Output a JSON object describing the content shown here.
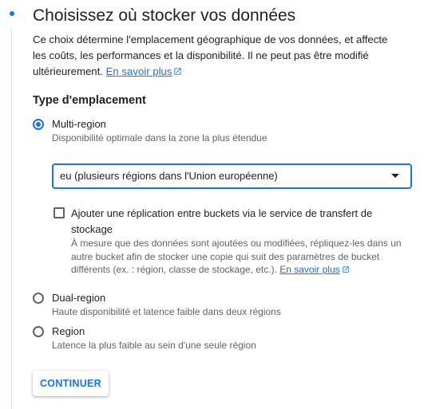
{
  "step": {
    "title": "Choisissez où stocker vos données",
    "description": "Ce choix détermine l'emplacement géographique de vos données, et affecte les coûts, les performances et la disponibilité. Il ne peut pas être modifié ultérieurement.",
    "learn_more": "En savoir plus"
  },
  "location_type": {
    "heading": "Type d'emplacement",
    "options": [
      {
        "label": "Multi-region",
        "description": "Disponibilité optimale dans la zone la plus étendue",
        "selected": true
      },
      {
        "label": "Dual-region",
        "description": "Haute disponibilité et latence faible dans deux régions",
        "selected": false
      },
      {
        "label": "Region",
        "description": "Latence la plus faible au sein d'une seule région",
        "selected": false
      }
    ]
  },
  "multi_region_select": {
    "value": "eu (plusieurs régions dans l'Union européenne)"
  },
  "replication": {
    "checked": false,
    "label": "Ajouter une réplication entre buckets via le service de transfert de stockage",
    "description": "À mesure que des données sont ajoutées ou modifiées, répliquez-les dans un autre bucket afin de stocker une copie qui suit des paramètres de bucket différents (ex. : région, classe de stockage, etc.).",
    "learn_more": "En savoir plus"
  },
  "continue_button": "CONTINUER",
  "colors": {
    "accent": "#1a73e8",
    "text": "#202124",
    "secondary_text": "#5f6368",
    "divider": "#dadce0"
  }
}
